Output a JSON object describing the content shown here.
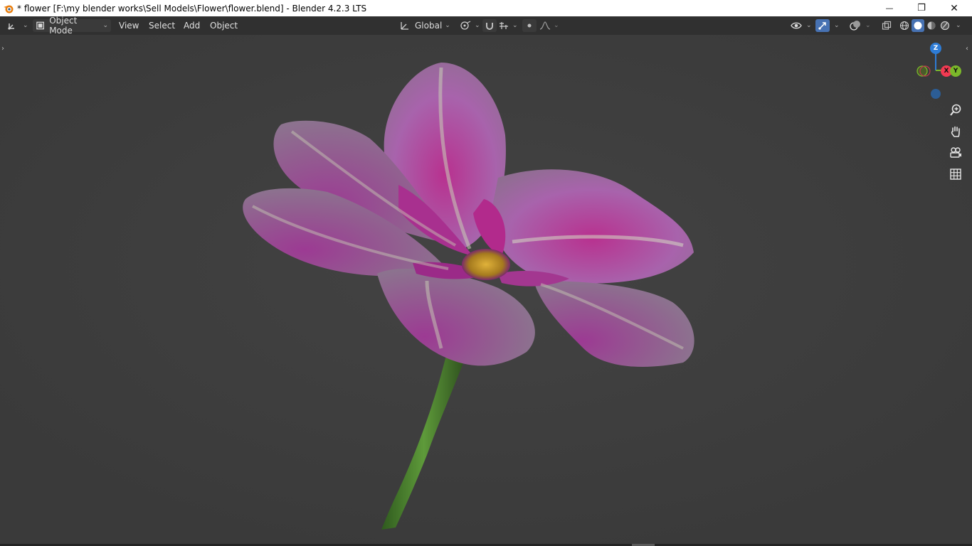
{
  "window": {
    "title": "* flower [F:\\my blender works\\Sell Models\\Flower\\flower.blend] - Blender 4.2.3 LTS",
    "minimize_glyph": "—",
    "restore_glyph": "❐",
    "close_glyph": "✕"
  },
  "header": {
    "editor_type_icon": "3d-viewport-icon",
    "mode_label": "Object Mode",
    "menus": [
      "View",
      "Select",
      "Add",
      "Object"
    ],
    "transform_orientation": "Global"
  },
  "gizmo": {
    "z_label": "Z",
    "x_label": "X",
    "y_label": "Y",
    "colors": {
      "x": "#f23a52",
      "y": "#7bb82a",
      "z": "#2e7cd6",
      "neg": "#4a5b2a"
    }
  },
  "viewport": {
    "background": "#3d3d3d",
    "object": "flower"
  },
  "colors": {
    "header_bg": "#303030",
    "active_icon_bg": "#4772b3",
    "petal": "#b060b5",
    "stem": "#4a7a2e"
  }
}
